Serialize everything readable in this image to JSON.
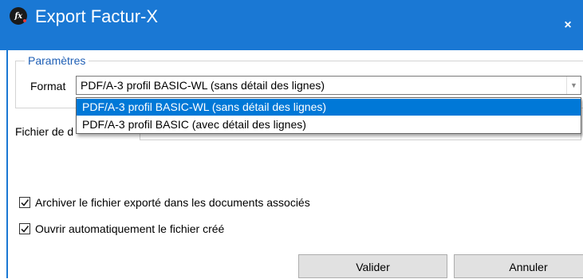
{
  "window": {
    "title": "Export Factur-X",
    "icon": "facturx-app-icon",
    "icon_text": "fx",
    "close_label": "×",
    "accent_color": "#1a78d4"
  },
  "parameters": {
    "legend": "Paramètres",
    "format_label": "Format",
    "format_value": "PDF/A-3 profil BASIC-WL (sans détail des lignes)",
    "format_options": [
      {
        "label": "PDF/A-3 profil BASIC-WL (sans détail des lignes)",
        "selected": true
      },
      {
        "label": "PDF/A-3 profil BASIC (avec détail des lignes)",
        "selected": false
      }
    ]
  },
  "file": {
    "label": "Fichier de d"
  },
  "options": {
    "archive_label": "Archiver le fichier exporté dans les documents associés",
    "archive_checked": true,
    "open_label": "Ouvrir automatiquement le fichier créé",
    "open_checked": true
  },
  "buttons": {
    "validate": "Valider",
    "cancel": "Annuler"
  }
}
